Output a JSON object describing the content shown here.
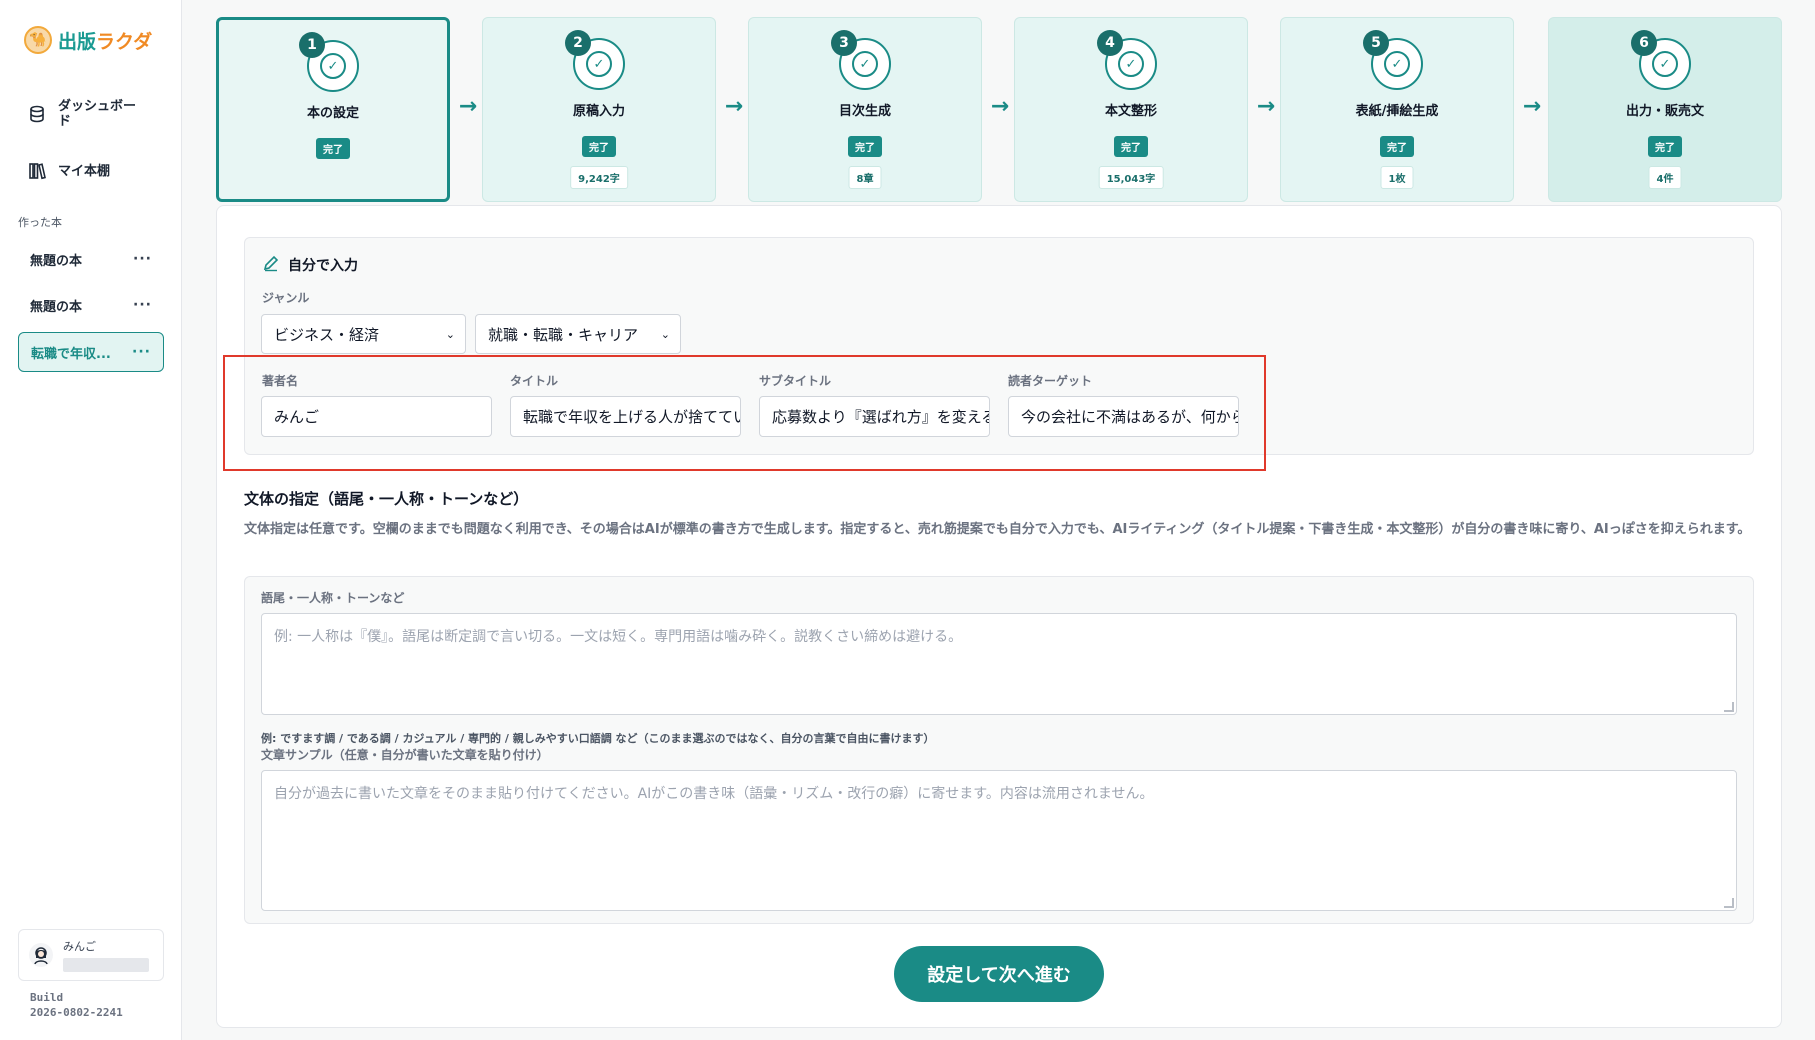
{
  "app": {
    "logo_part1": "出版",
    "logo_part2": "ラクダ"
  },
  "sidebar": {
    "nav": [
      {
        "label": "ダッシュボード",
        "icon": "database-icon"
      },
      {
        "label": "マイ本棚",
        "icon": "bookshelf-icon"
      }
    ],
    "section_label": "作った本",
    "books": [
      {
        "title": "無題の本",
        "active": false
      },
      {
        "title": "無題の本",
        "active": false
      },
      {
        "title": "転職で年収...",
        "active": true
      }
    ],
    "user": {
      "name": "みんご"
    },
    "build_label": "Build",
    "build_id": "2026-0802-2241"
  },
  "steps": [
    {
      "num": "1",
      "title": "本の設定",
      "status": "完了",
      "count": ""
    },
    {
      "num": "2",
      "title": "原稿入力",
      "status": "完了",
      "count": "9,242字"
    },
    {
      "num": "3",
      "title": "目次生成",
      "status": "完了",
      "count": "8章"
    },
    {
      "num": "4",
      "title": "本文整形",
      "status": "完了",
      "count": "15,043字"
    },
    {
      "num": "5",
      "title": "表紙/挿絵生成",
      "status": "完了",
      "count": "1枚"
    },
    {
      "num": "6",
      "title": "出力・販売文",
      "status": "完了",
      "count": "4件"
    }
  ],
  "form": {
    "panel_title": "自分で入力",
    "genre_label": "ジャンル",
    "genre_value": "ビジネス・経済",
    "subgenre_value": "就職・転職・キャリア",
    "author_label": "著者名",
    "author_value": "みんご",
    "title_label": "タイトル",
    "title_value": "転職で年収を上げる人が捨てているもの",
    "subtitle_label": "サブタイトル",
    "subtitle_value": "応募数より『選ばれ方』を変える",
    "target_label": "読者ターゲット",
    "target_value": "今の会社に不満はあるが、何から"
  },
  "style": {
    "heading": "文体の指定（語尾・一人称・トーンなど）",
    "description": "文体指定は任意です。空欄のままでも問題なく利用でき、その場合はAIが標準の書き方で生成します。指定すると、売れ筋提案でも自分で入力でも、AIライティング（タイトル提案・下書き生成・本文整形）が自分の書き味に寄り、AIっぽさを抑えられます。",
    "tone_label": "語尾・一人称・トーンなど",
    "tone_placeholder": "例: 一人称は『僕』。語尾は断定調で言い切る。一文は短く。専門用語は噛み砕く。説教くさい締めは避ける。",
    "tone_hint": "例: ですます調 / である調 / カジュアル / 専門的 / 親しみやすい口語調 など（このまま選ぶのではなく、自分の言葉で自由に書けます）",
    "sample_label": "文章サンプル（任意・自分が書いた文章を貼り付け）",
    "sample_placeholder": "自分が過去に書いた文章をそのまま貼り付けてください。AIがこの書き味（語彙・リズム・改行の癖）に寄せます。内容は流用されません。"
  },
  "submit_label": "設定して次へ進む",
  "colors": {
    "accent": "#1a8b86",
    "highlight": "#e0392b",
    "logo_orange": "#f08a24"
  }
}
